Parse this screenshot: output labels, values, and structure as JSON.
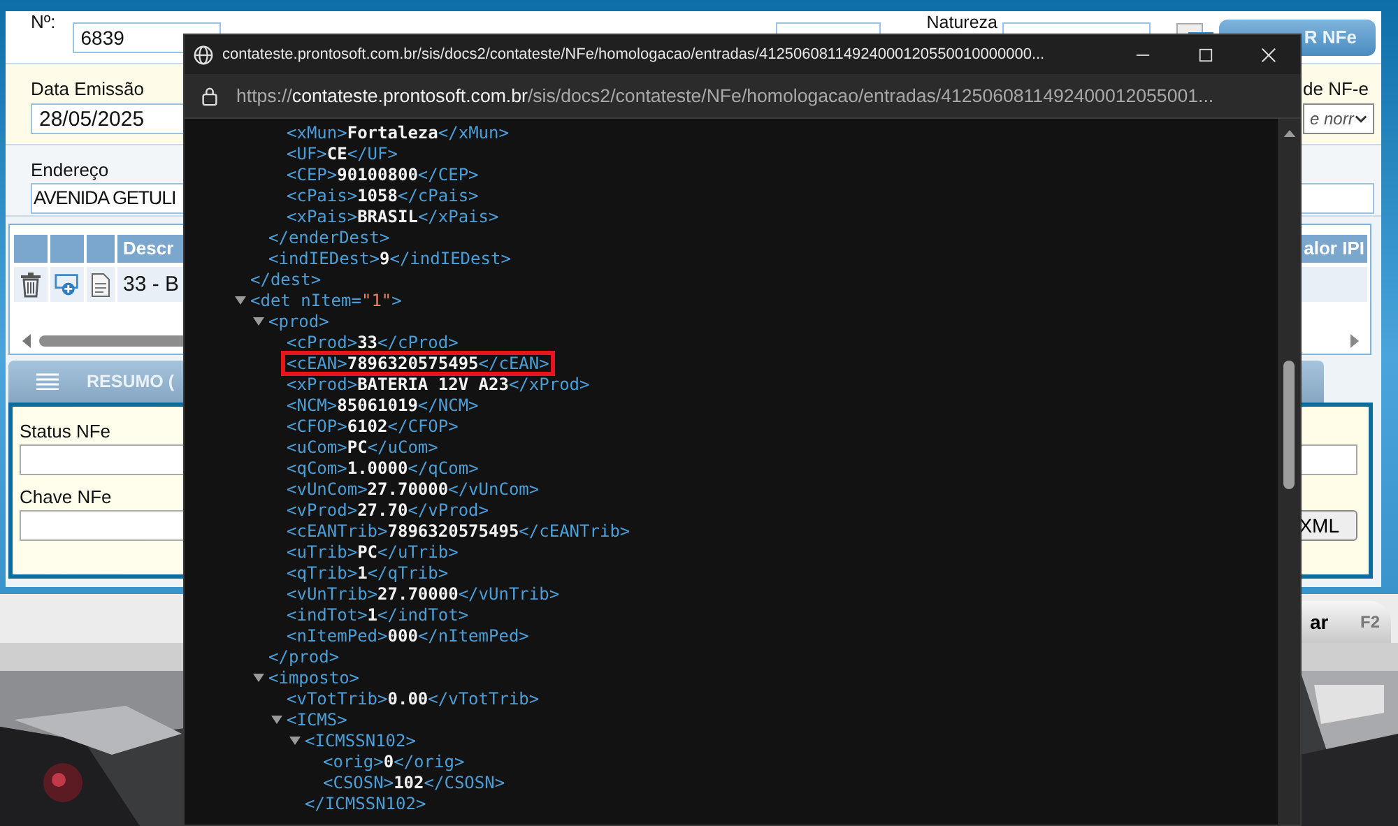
{
  "form": {
    "number": {
      "label": "Nº:",
      "value": "6839"
    },
    "natureza_label": "Natureza",
    "clone_button": "R NFe",
    "emission_date": {
      "label": "Data Emissão",
      "value": "28/05/2025"
    },
    "purpose": {
      "label": "de NF-e",
      "value": "e norr"
    },
    "address": {
      "label": "Endereço",
      "value": "AVENIDA GETULI"
    }
  },
  "items_table": {
    "columns": [
      "Descr",
      "alor IPI"
    ],
    "rows": [
      {
        "description": "33 - B"
      }
    ]
  },
  "summary": {
    "title": "RESUMO (",
    "fields": [
      {
        "label": "Status NFe"
      },
      {
        "label": "Chave NFe"
      }
    ],
    "xml_button": "XML"
  },
  "footer_button": {
    "label": "ar",
    "shortcut": "F2"
  },
  "popup": {
    "title": "contateste.prontosoft.com.br/sis/docs2/contateste/NFe/homologacao/entradas/41250608114924000120550010000000...",
    "url_scheme": "https://",
    "url_host": "contateste.prontosoft.com.br",
    "url_path": "/sis/docs2/contateste/NFe/homologacao/entradas/4125060811492400012055001..."
  },
  "xml": [
    {
      "kind": "element",
      "close_tag": "</dest>",
      "children": [
        {
          "kind": "element",
          "close_tag": "</enderDest>",
          "children": [
            {
              "kind": "leaf",
              "open_tag": "<xMun>",
              "value": "Fortaleza",
              "close_tag": "</xMun>",
              "highlighted": false
            },
            {
              "kind": "leaf",
              "open_tag": "<UF>",
              "value": "CE",
              "close_tag": "</UF>",
              "highlighted": false
            },
            {
              "kind": "leaf",
              "open_tag": "<CEP>",
              "value": "90100800",
              "close_tag": "</CEP>",
              "highlighted": false
            },
            {
              "kind": "leaf",
              "open_tag": "<cPais>",
              "value": "1058",
              "close_tag": "</cPais>",
              "highlighted": false
            },
            {
              "kind": "leaf",
              "open_tag": "<xPais>",
              "value": "BRASIL",
              "close_tag": "</xPais>",
              "highlighted": false
            }
          ]
        },
        {
          "kind": "leaf",
          "open_tag": "<indIEDest>",
          "value": "9",
          "close_tag": "</indIEDest>",
          "highlighted": false
        }
      ]
    },
    {
      "kind": "element",
      "open_tag": "<det",
      "attribute": " nItem=",
      "attribute_value": "\"1\"",
      "open_tag_end": ">",
      "expanded": true,
      "children": [
        {
          "kind": "element",
          "open_tag": "<prod>",
          "close_tag": "</prod>",
          "expanded": true,
          "children": [
            {
              "kind": "leaf",
              "open_tag": "<cProd>",
              "value": "33",
              "close_tag": "</cProd>",
              "highlighted": false
            },
            {
              "kind": "leaf",
              "open_tag": "<cEAN>",
              "value": "7896320575495",
              "close_tag": "</cEAN>",
              "highlighted": true
            },
            {
              "kind": "leaf",
              "open_tag": "<xProd>",
              "value": "BATERIA 12V A23",
              "close_tag": "</xProd>",
              "highlighted": false
            },
            {
              "kind": "leaf",
              "open_tag": "<NCM>",
              "value": "85061019",
              "close_tag": "</NCM>",
              "highlighted": false
            },
            {
              "kind": "leaf",
              "open_tag": "<CFOP>",
              "value": "6102",
              "close_tag": "</CFOP>",
              "highlighted": false
            },
            {
              "kind": "leaf",
              "open_tag": "<uCom>",
              "value": "PC",
              "close_tag": "</uCom>",
              "highlighted": false
            },
            {
              "kind": "leaf",
              "open_tag": "<qCom>",
              "value": "1.0000",
              "close_tag": "</qCom>",
              "highlighted": false
            },
            {
              "kind": "leaf",
              "open_tag": "<vUnCom>",
              "value": "27.70000",
              "close_tag": "</vUnCom>",
              "highlighted": false
            },
            {
              "kind": "leaf",
              "open_tag": "<vProd>",
              "value": "27.70",
              "close_tag": "</vProd>",
              "highlighted": false
            },
            {
              "kind": "leaf",
              "open_tag": "<cEANTrib>",
              "value": "7896320575495",
              "close_tag": "</cEANTrib>",
              "highlighted": false
            },
            {
              "kind": "leaf",
              "open_tag": "<uTrib>",
              "value": "PC",
              "close_tag": "</uTrib>",
              "highlighted": false
            },
            {
              "kind": "leaf",
              "open_tag": "<qTrib>",
              "value": "1",
              "close_tag": "</qTrib>",
              "highlighted": false
            },
            {
              "kind": "leaf",
              "open_tag": "<vUnTrib>",
              "value": "27.70000",
              "close_tag": "</vUnTrib>",
              "highlighted": false
            },
            {
              "kind": "leaf",
              "open_tag": "<indTot>",
              "value": "1",
              "close_tag": "</indTot>",
              "highlighted": false
            },
            {
              "kind": "leaf",
              "open_tag": "<nItemPed>",
              "value": "000",
              "close_tag": "</nItemPed>",
              "highlighted": false
            }
          ]
        },
        {
          "kind": "element",
          "open_tag": "<imposto>",
          "expanded": true,
          "children": [
            {
              "kind": "leaf",
              "open_tag": "<vTotTrib>",
              "value": "0.00",
              "close_tag": "</vTotTrib>",
              "highlighted": false
            },
            {
              "kind": "element",
              "open_tag": "<ICMS>",
              "expanded": true,
              "children": [
                {
                  "kind": "element",
                  "open_tag": "<ICMSSN102>",
                  "close_tag": "</ICMSSN102>",
                  "expanded": true,
                  "children": [
                    {
                      "kind": "leaf",
                      "open_tag": "<orig>",
                      "value": "0",
                      "close_tag": "</orig>",
                      "highlighted": false
                    },
                    {
                      "kind": "leaf",
                      "open_tag": "<CSOSN>",
                      "value": "102",
                      "close_tag": "</CSOSN>",
                      "highlighted": false
                    }
                  ]
                }
              ]
            }
          ]
        }
      ]
    }
  ]
}
